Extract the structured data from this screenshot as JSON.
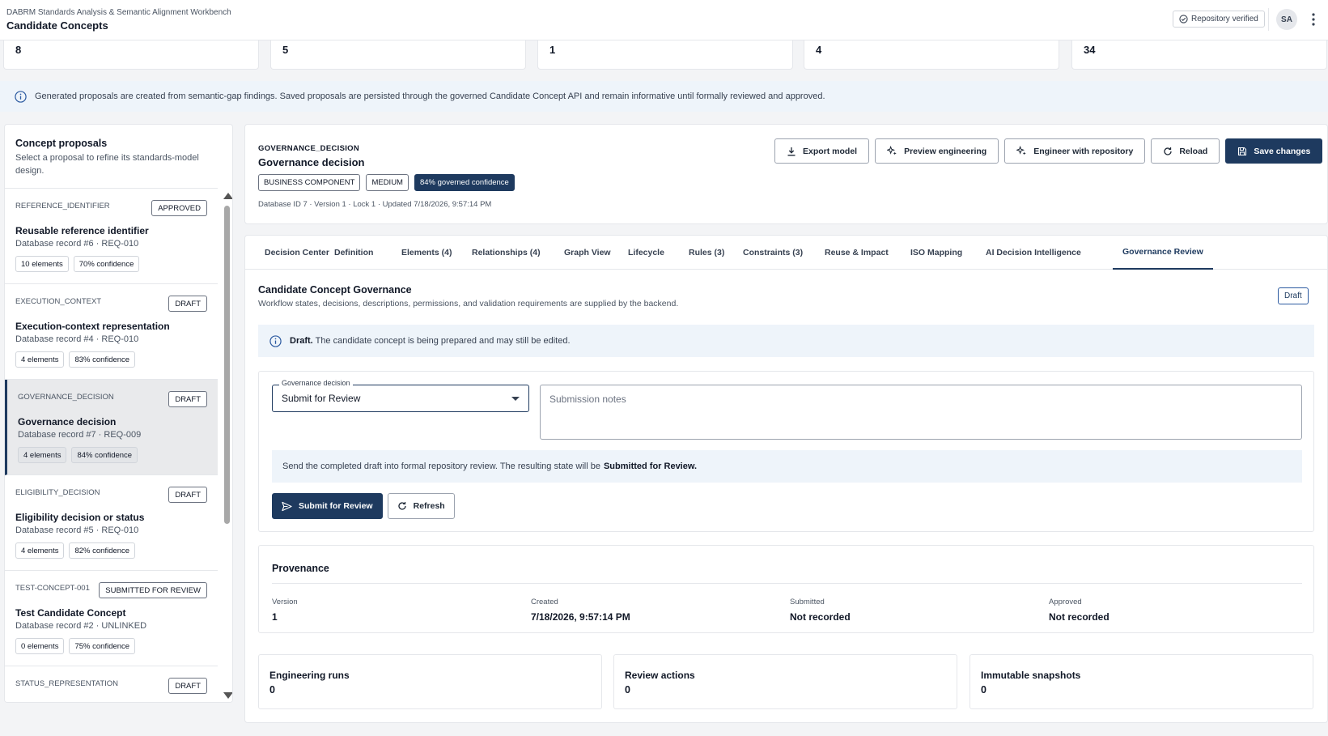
{
  "header": {
    "subtitle": "DABRM Standards Analysis & Semantic Alignment Workbench",
    "title": "Candidate Concepts",
    "repo_status": "Repository verified",
    "avatar_initials": "SA",
    "more_icon": "more-vertical-icon"
  },
  "stats": [
    "8",
    "5",
    "1",
    "4",
    "34"
  ],
  "info_banner": "Generated proposals are created from semantic-gap findings. Saved proposals are persisted through the governed Candidate Concept API and remain informative until formally reviewed and approved.",
  "left_panel": {
    "title": "Concept proposals",
    "description": "Select a proposal to refine its standards-model design.",
    "proposals": [
      {
        "code": "REFERENCE_IDENTIFIER",
        "status": "APPROVED",
        "name": "Reusable reference identifier",
        "record": "Database record #6 · REQ-010",
        "elements": "10 elements",
        "confidence": "70% confidence"
      },
      {
        "code": "EXECUTION_CONTEXT",
        "status": "DRAFT",
        "name": "Execution-context representation",
        "record": "Database record #4 · REQ-010",
        "elements": "4 elements",
        "confidence": "83% confidence"
      },
      {
        "code": "GOVERNANCE_DECISION",
        "status": "DRAFT",
        "name": "Governance decision",
        "record": "Database record #7 · REQ-009",
        "elements": "4 elements",
        "confidence": "84% confidence"
      },
      {
        "code": "ELIGIBILITY_DECISION",
        "status": "DRAFT",
        "name": "Eligibility decision or status",
        "record": "Database record #5 · REQ-010",
        "elements": "4 elements",
        "confidence": "82% confidence"
      },
      {
        "code": "TEST-CONCEPT-001",
        "status": "SUBMITTED FOR REVIEW",
        "name": "Test Candidate Concept",
        "record": "Database record #2 · UNLINKED",
        "elements": "0 elements",
        "confidence": "75% confidence"
      },
      {
        "code": "STATUS_REPRESENTATION",
        "status": "DRAFT"
      }
    ]
  },
  "detail": {
    "code": "GOVERNANCE_DECISION",
    "name": "Governance decision",
    "badges": [
      "BUSINESS COMPONENT",
      "MEDIUM",
      "84% governed confidence"
    ],
    "meta": "Database ID 7 · Version 1 · Lock 1 · Updated 7/18/2026, 9:57:14 PM",
    "actions": {
      "export": "Export model",
      "preview": "Preview engineering",
      "engineer": "Engineer with repository",
      "reload": "Reload",
      "save": "Save changes"
    }
  },
  "tabs": [
    "Decision Center",
    "Definition",
    "Elements (4)",
    "Relationships (4)",
    "Graph View",
    "Lifecycle",
    "Rules (3)",
    "Constraints (3)",
    "Reuse & Impact",
    "ISO Mapping",
    "AI Decision Intelligence",
    "Governance Review"
  ],
  "governance": {
    "title": "Candidate Concept Governance",
    "description": "Workflow states, decisions, descriptions, permissions, and validation requirements are supplied by the backend.",
    "state_badge": "Draft",
    "state_label": "Draft.",
    "state_text": "The candidate concept is being prepared and may still be edited.",
    "decision_label": "Governance decision",
    "decision_value": "Submit for Review",
    "notes_placeholder": "Submission notes",
    "note_text": "Send the completed draft into formal repository review. The resulting state will be",
    "note_state": "Submitted for Review.",
    "submit_label": "Submit for Review",
    "refresh_label": "Refresh"
  },
  "provenance": {
    "title": "Provenance",
    "items": [
      {
        "label": "Version",
        "value": "1"
      },
      {
        "label": "Created",
        "value": "7/18/2026, 9:57:14 PM"
      },
      {
        "label": "Submitted",
        "value": "Not recorded"
      },
      {
        "label": "Approved",
        "value": "Not recorded"
      }
    ]
  },
  "metrics": [
    {
      "label": "Engineering runs",
      "value": "0"
    },
    {
      "label": "Review actions",
      "value": "0"
    },
    {
      "label": "Immutable snapshots",
      "value": "0"
    }
  ],
  "colors": {
    "primary": "#1e3a5f",
    "info_bg": "#eef4fa",
    "border": "#e5e7eb"
  }
}
